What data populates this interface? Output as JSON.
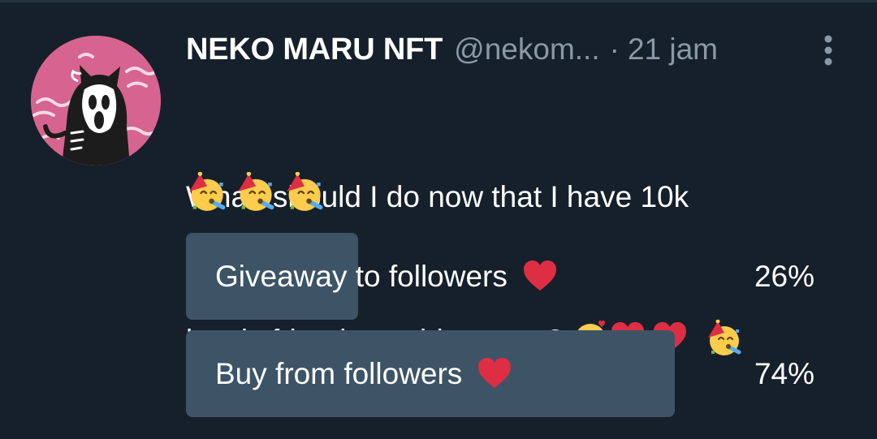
{
  "tweet": {
    "display_name": "NEKO MARU NFT",
    "handle": "@nekom...",
    "separator": "·",
    "timestamp": "21 jam",
    "text_line1": "What  should I do now that I have 10k",
    "text_line2": "lovely friends on this space? ",
    "emojis_line2": [
      "smiling-face-with-hearts",
      "red-heart",
      "red-heart",
      "partying-face"
    ],
    "emojis_line3": [
      "partying-face",
      "partying-face",
      "partying-face"
    ]
  },
  "poll": {
    "options": [
      {
        "label": "Giveaway to followers",
        "emoji": "red-heart",
        "percent_text": "26%",
        "percent": 26
      },
      {
        "label": "Buy from followers",
        "emoji": "red-heart",
        "percent_text": "74%",
        "percent": 74
      }
    ],
    "colors": {
      "bar": "#3d5466",
      "background": "#15202b",
      "muted_text": "#8b98a5"
    }
  }
}
